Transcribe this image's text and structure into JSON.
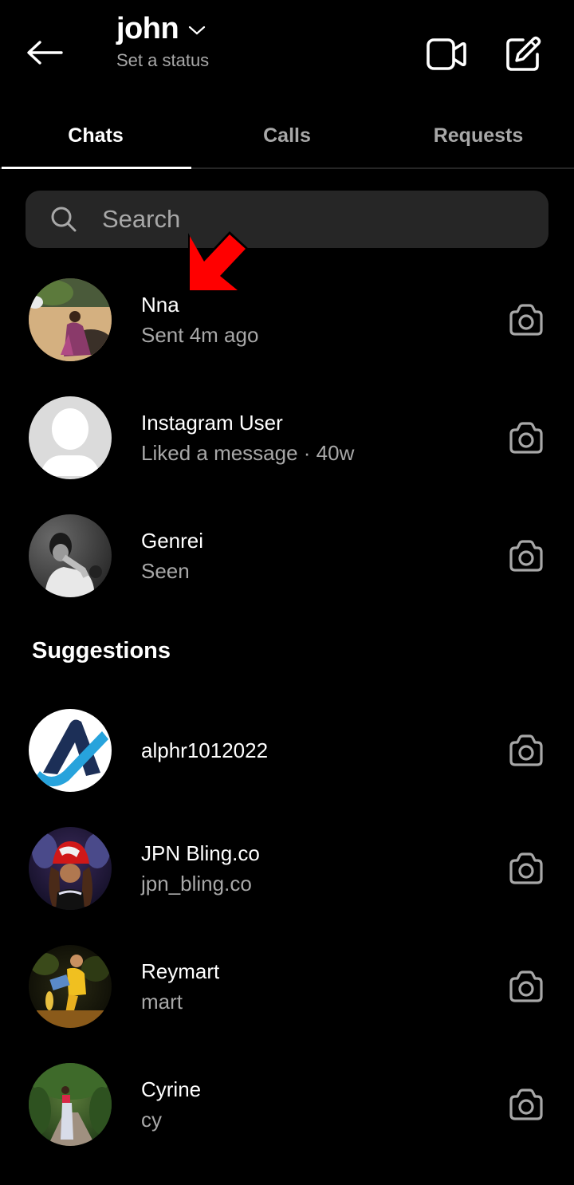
{
  "header": {
    "username": "john",
    "status_label": "Set a status",
    "icons": {
      "back": "arrow-left-icon",
      "dropdown": "chevron-down-icon",
      "video": "video-camera-icon",
      "compose": "compose-edit-icon"
    }
  },
  "tabs": [
    {
      "label": "Chats",
      "active": true
    },
    {
      "label": "Calls",
      "active": false
    },
    {
      "label": "Requests",
      "active": false
    }
  ],
  "search": {
    "placeholder": "Search",
    "value": ""
  },
  "chats": [
    {
      "name": "Nna",
      "subtitle": "Sent 4m ago",
      "avatar": "photo-beach"
    },
    {
      "name": "Instagram User",
      "subtitle": "Liked a message · 40w",
      "avatar": "default-silhouette"
    },
    {
      "name": "Genrei",
      "subtitle": "Seen",
      "avatar": "photo-bw"
    }
  ],
  "suggestions_title": "Suggestions",
  "suggestions": [
    {
      "name": "alphr1012022",
      "subtitle": "",
      "avatar": "logo-alphr"
    },
    {
      "name": "JPN Bling.co",
      "subtitle": "jpn_bling.co",
      "avatar": "photo-red-cap"
    },
    {
      "name": "Reymart",
      "subtitle": "mart",
      "avatar": "photo-yellow-jacket"
    },
    {
      "name": "Cyrine",
      "subtitle": "cy",
      "avatar": "photo-forest"
    }
  ],
  "annotation": {
    "arrow_color": "#ff0000",
    "points_to": "Nna"
  },
  "colors": {
    "background": "#000000",
    "secondary_text": "#a8a8a8",
    "search_bg": "#262626"
  }
}
